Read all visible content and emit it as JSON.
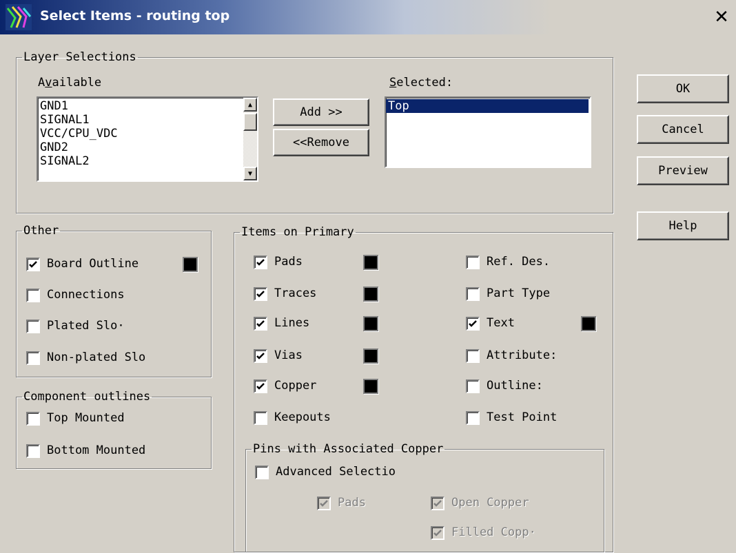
{
  "window": {
    "title": "Select Items - routing top",
    "close_symbol": "✕"
  },
  "layer_selections": {
    "legend": "Layer Selections",
    "available_label": "Available",
    "available_items": [
      "GND1",
      "SIGNAL1",
      "VCC/CPU_VDC",
      "GND2",
      "SIGNAL2"
    ],
    "selected_label": "Selected:",
    "selected_items": [
      "Top"
    ],
    "add_button": "Add >>",
    "remove_button": "<<Remove"
  },
  "buttons": {
    "ok": "OK",
    "cancel": "Cancel",
    "preview": "Preview",
    "help": "Help"
  },
  "other": {
    "legend": "Other",
    "items": [
      {
        "label": "Board Outline",
        "checked": true,
        "color": "#000000"
      },
      {
        "label": "Connections",
        "checked": false
      },
      {
        "label": "Plated Slo·",
        "checked": false
      },
      {
        "label": "Non-plated Slo",
        "checked": false
      }
    ]
  },
  "component_outlines": {
    "legend": "Component outlines",
    "items": [
      {
        "label": "Top Mounted",
        "checked": false
      },
      {
        "label": "Bottom Mounted",
        "checked": false
      }
    ]
  },
  "items_on_primary": {
    "legend": "Items on Primary",
    "left": [
      {
        "label": "Pads",
        "checked": true,
        "color": "#000000"
      },
      {
        "label": "Traces",
        "checked": true,
        "color": "#000000"
      },
      {
        "label": "Lines",
        "checked": true,
        "color": "#000000"
      },
      {
        "label": "Vias",
        "checked": true,
        "color": "#000000"
      },
      {
        "label": "Copper",
        "checked": true,
        "color": "#000000"
      },
      {
        "label": "Keepouts",
        "checked": false
      }
    ],
    "right": [
      {
        "label": "Ref. Des.",
        "checked": false
      },
      {
        "label": "Part Type",
        "checked": false
      },
      {
        "label": "Text",
        "checked": true,
        "color": "#000000"
      },
      {
        "label": "Attribute:",
        "checked": false
      },
      {
        "label": "Outline:",
        "checked": false
      },
      {
        "label": "Test Point",
        "checked": false
      }
    ]
  },
  "pins_associated_copper": {
    "legend": "Pins with Associated Copper",
    "advanced": {
      "label": "Advanced Selectio",
      "checked": false
    },
    "pads": {
      "label": "Pads",
      "checked": true,
      "disabled": true
    },
    "open_copper": {
      "label": "Open Copper",
      "checked": true,
      "disabled": true
    },
    "filled_copper": {
      "label": "Filled Copp·",
      "checked": true,
      "disabled": true
    }
  },
  "colors": {
    "title_active": "#0a246a",
    "dialog_face": "#d4d0c8",
    "selection": "#0a246a",
    "swatch": "#000000"
  }
}
